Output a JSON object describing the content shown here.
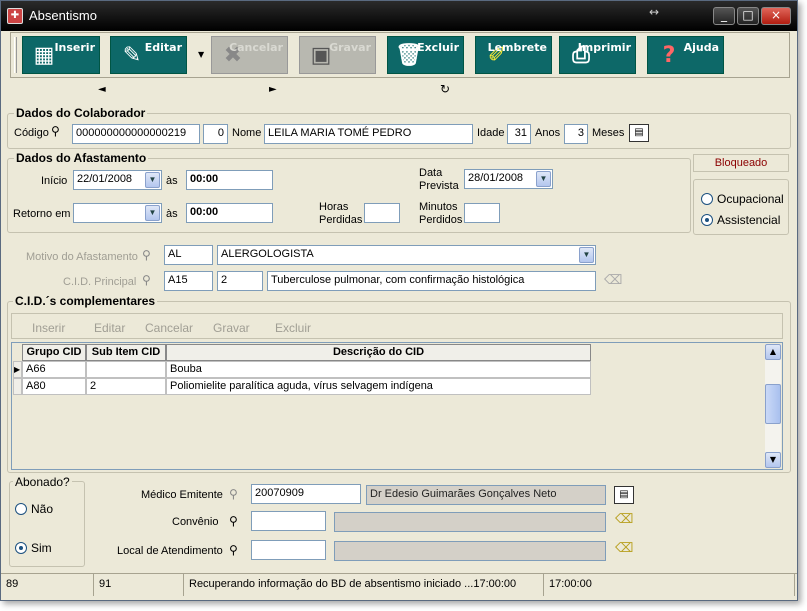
{
  "window": {
    "title": "Absentismo",
    "min": "_",
    "max": "□",
    "close": "×",
    "resize_glyph": "↔"
  },
  "toolbar": {
    "buttons": [
      {
        "label": "Inserir",
        "icon": "insert-icon",
        "enabled": true
      },
      {
        "label": "Editar",
        "icon": "edit-icon",
        "enabled": true
      },
      {
        "label": "Cancelar",
        "icon": "cancel-icon",
        "enabled": false
      },
      {
        "label": "Gravar",
        "icon": "save-icon",
        "enabled": false
      },
      {
        "label": "Excluir",
        "icon": "trash-icon",
        "enabled": true
      },
      {
        "label": "Lembrete",
        "icon": "note-icon",
        "enabled": true
      },
      {
        "label": "Imprimir",
        "icon": "printer-icon",
        "enabled": true
      },
      {
        "label": "Ajuda",
        "icon": "help-icon",
        "enabled": true
      }
    ],
    "accent": "#0d6868"
  },
  "nav": {
    "prev": "◄",
    "next": "►",
    "refresh": "↻"
  },
  "colaborador": {
    "legend": "Dados do Colaborador",
    "codigo_label": "Código",
    "codigo": "000000000000000219",
    "digito": "0",
    "nome_label": "Nome",
    "nome": "LEILA MARIA TOMÉ PEDRO",
    "idade_label": "Idade",
    "idade": "31",
    "anos_label": "Anos",
    "meses": "3",
    "meses_label": "Meses"
  },
  "afastamento": {
    "legend": "Dados do Afastamento",
    "inicio_label": "Início",
    "inicio_data": "22/01/2008",
    "as_label": "às",
    "inicio_hora": "00:00",
    "retorno_label": "Retorno em",
    "retorno_data": "",
    "retorno_hora": "00:00",
    "data_prevista_label1": "Data",
    "data_prevista_label2": "Prevista",
    "data_prevista": "28/01/2008",
    "horas_perdidas_label1": "Horas",
    "horas_perdidas_label2": "Perdidas",
    "horas_perdidas": "",
    "minutos_perdidos_label1": "Minutos",
    "minutos_perdidos_label2": "Perdidos",
    "minutos_perdidos": ""
  },
  "bloqueado": "Bloqueado",
  "tipo": {
    "ocupacional": "Ocupacional",
    "assistencial": "Assistencial",
    "selected": "assistencial"
  },
  "motivo": {
    "label": "Motivo do Afastamento",
    "codigo": "AL",
    "descricao": "ALERGOLOGISTA"
  },
  "cid": {
    "label": "C.I.D. Principal",
    "grupo": "A15",
    "sub": "2",
    "descricao": "Tuberculose pulmonar, com confirmação histológica"
  },
  "cid_comp": {
    "legend": "C.I.D.´s complementares",
    "toolbar": [
      "Inserir",
      "Editar",
      "Cancelar",
      "Gravar",
      "Excluir"
    ],
    "columns": [
      "Grupo CID",
      "Sub Item CID",
      "Descrição do CID"
    ],
    "rows": [
      [
        "A66",
        "",
        "Bouba"
      ],
      [
        "A80",
        "2",
        "Poliomielite paralítica aguda, vírus selvagem indígena"
      ]
    ]
  },
  "abonado": {
    "legend": "Abonado?",
    "nao": "Não",
    "sim": "Sim",
    "selected": "sim"
  },
  "medico": {
    "label": "Médico Emitente",
    "codigo": "20070909",
    "nome": "Dr Edesio Guimarães Gonçalves Neto"
  },
  "convenio": {
    "label": "Convênio",
    "codigo": "",
    "nome": ""
  },
  "local": {
    "label": "Local de Atendimento",
    "codigo": "",
    "nome": ""
  },
  "status": {
    "p1": "89",
    "p2": "91",
    "msg": "Recuperando informação do BD de absentismo iniciado ...17:00:00",
    "time": "17:00:00"
  }
}
